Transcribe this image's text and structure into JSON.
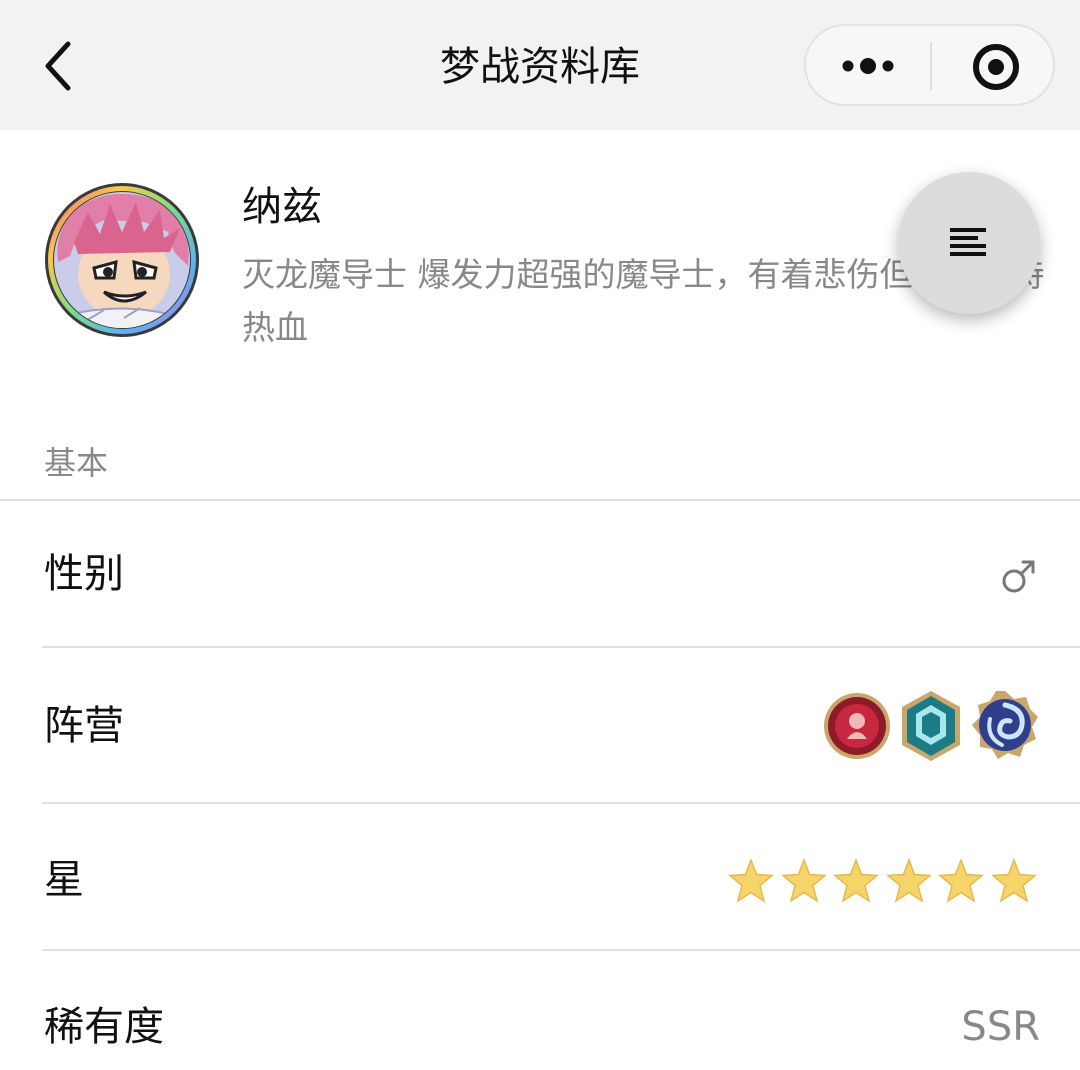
{
  "header": {
    "title": "梦战资料库",
    "back_icon": "chevron-left-icon",
    "more_icon": "more-dots-icon",
    "close_icon": "target-close-icon"
  },
  "hero": {
    "name": "纳兹",
    "description": "灭龙魔导士 爆发力超强的魔导士，有着悲伤但始终保持热血",
    "avatar_icon": "hero-avatar",
    "menu_icon": "menu-lines-icon"
  },
  "section": {
    "label": "基本"
  },
  "rows": {
    "gender": {
      "label": "性别",
      "value_icon": "male-symbol-icon"
    },
    "faction": {
      "label": "阵营",
      "badges": [
        "red-faction-badge-icon",
        "teal-crystal-badge-icon",
        "blue-swirl-badge-icon"
      ]
    },
    "stars": {
      "label": "星",
      "count": 6,
      "star_color": "#f5d46a"
    },
    "rarity": {
      "label": "稀有度",
      "value": "SSR"
    }
  },
  "colors": {
    "topbar_bg": "#f2f2f2",
    "text_primary": "#111111",
    "text_secondary": "#888888",
    "divider": "#e0e0e0"
  }
}
